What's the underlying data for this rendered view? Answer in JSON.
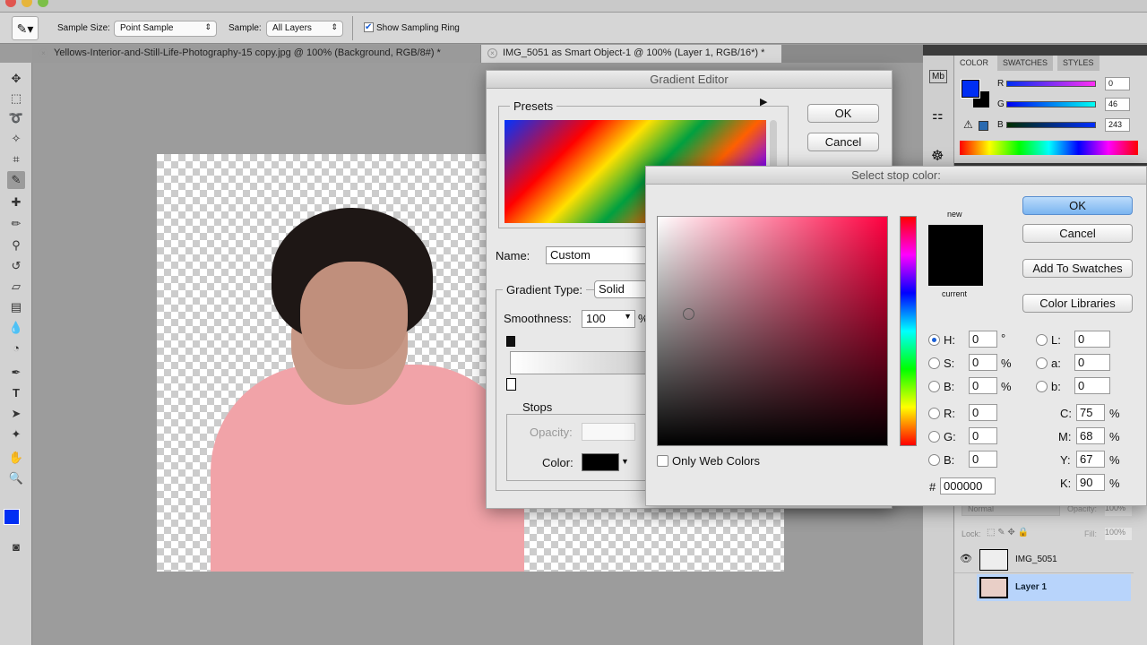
{
  "options_bar": {
    "sample_size_label": "Sample Size:",
    "sample_size_value": "Point Sample",
    "sample_label": "Sample:",
    "sample_value": "All Layers",
    "show_ring_label": "Show Sampling Ring",
    "show_ring_checked": true
  },
  "tabs": [
    {
      "label": "Yellows-Interior-and-Still-Life-Photography-15 copy.jpg @ 100% (Background, RGB/8#) *",
      "active": false
    },
    {
      "label": "IMG_5051 as Smart Object-1 @ 100% (Layer 1, RGB/16*) *",
      "active": true
    }
  ],
  "color_panel": {
    "tabs": [
      "COLOR",
      "SWATCHES",
      "STYLES"
    ],
    "r_label": "R",
    "g_label": "G",
    "b_label": "B",
    "r": "0",
    "g": "46",
    "b": "243",
    "foreground": "#002ef3",
    "background": "#000000"
  },
  "layers_panel": {
    "blend_mode": "Normal",
    "opacity_label": "Opacity:",
    "opacity": "100%",
    "lock_label": "Lock:",
    "fill_label": "Fill:",
    "fill": "100%",
    "layers": [
      {
        "name": "IMG_5051",
        "visible": true,
        "selected": false
      },
      {
        "name": "Layer 1",
        "visible": false,
        "selected": true
      }
    ]
  },
  "gradient_editor": {
    "title": "Gradient Editor",
    "presets_label": "Presets",
    "ok": "OK",
    "cancel": "Cancel",
    "name_label": "Name:",
    "name_value": "Custom",
    "type_label": "Gradient Type:",
    "type_value": "Solid",
    "smoothness_label": "Smoothness:",
    "smoothness_value": "100",
    "percent": "%",
    "stops_label": "Stops",
    "opacity_label": "Opacity:",
    "color_label": "Color:",
    "stop_color": "#000000"
  },
  "color_picker": {
    "title": "Select stop color:",
    "ok": "OK",
    "cancel": "Cancel",
    "add_swatches": "Add To Swatches",
    "libraries": "Color Libraries",
    "new_label": "new",
    "current_label": "current",
    "new_color": "#000000",
    "current_color": "#000000",
    "only_web": "Only Web Colors",
    "hue_color": "#ff0040",
    "fields": {
      "H": "0",
      "S": "0",
      "B": "0",
      "R": "0",
      "G": "0",
      "Bv": "0",
      "L": "0",
      "a": "0",
      "b": "0",
      "C": "75",
      "M": "68",
      "Y": "67",
      "K": "90",
      "hex": "000000"
    },
    "units": {
      "deg": "°",
      "pct": "%"
    }
  }
}
